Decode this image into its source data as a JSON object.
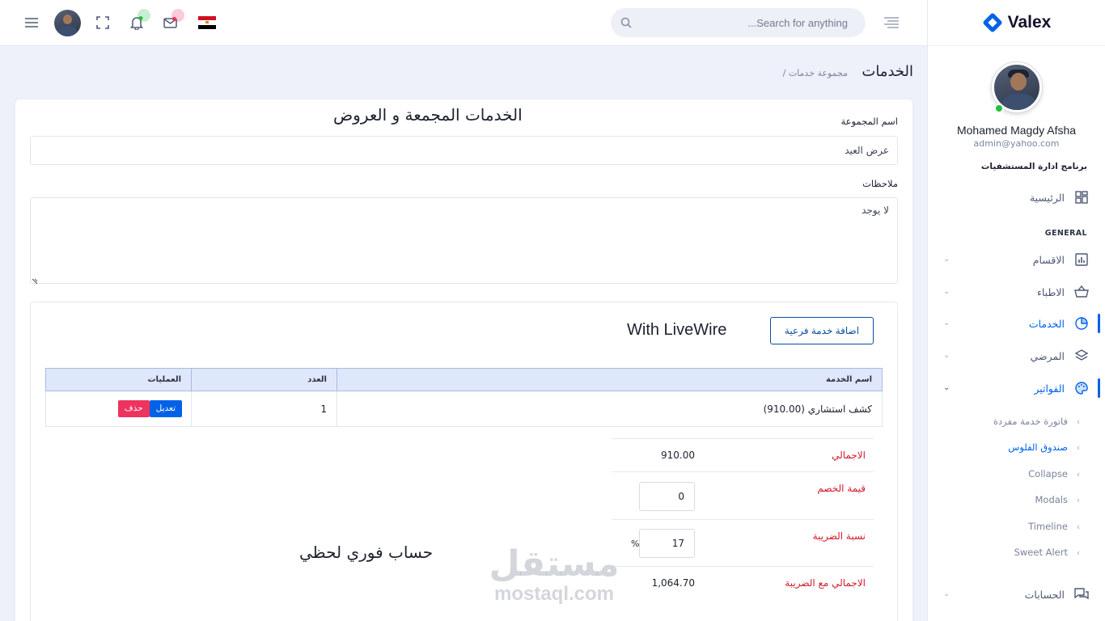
{
  "brand": {
    "name": "Valex"
  },
  "header": {
    "search_placeholder": "...Search for anything"
  },
  "profile": {
    "name": "Mohamed Magdy Afsha",
    "email": "admin@yahoo.com",
    "online_color": "#22c03c"
  },
  "sidebar": {
    "app_title": "برنامج ادارة المستشفيات",
    "home": "الرئيسية",
    "section": "GENERAL",
    "items": [
      {
        "label": "الاقسام",
        "icon": "bar-chart-icon"
      },
      {
        "label": "الاطباء",
        "icon": "basket-icon"
      },
      {
        "label": "الخدمات",
        "icon": "pie-chart-icon",
        "active": true
      },
      {
        "label": "المرضي",
        "icon": "layers-icon"
      },
      {
        "label": "الفواتير",
        "icon": "palette-icon",
        "active": true,
        "expanded": true
      }
    ],
    "sub_items": [
      {
        "label": "فاتورة خدمة مفردة"
      },
      {
        "label": "صندوق الفلوس",
        "active": true
      },
      {
        "label": "Collapse"
      },
      {
        "label": "Modals"
      },
      {
        "label": "Timeline"
      },
      {
        "label": "Sweet Alert"
      }
    ],
    "accounts": "الحسابات"
  },
  "breadcrumb": {
    "title": "الخدمات",
    "sub": "/ مجموعة خدمات"
  },
  "form": {
    "card_title": "الخدمات المجمعة و العروض",
    "group_name_label": "اسم المجموعة",
    "group_name_value": "عرض العيد",
    "notes_label": "ملاحظات",
    "notes_value": "لا يوجد"
  },
  "services": {
    "add_button": "اضافة خدمة فرعية",
    "livewire_title": "With LiveWire",
    "columns": [
      "اسم الخدمة",
      "العدد",
      "العمليات"
    ],
    "rows": [
      {
        "name": "كشف استشاري (910.00)",
        "count": "1",
        "edit": "تعديل",
        "delete": "حذف"
      }
    ]
  },
  "totals": {
    "total_label": "الاجمالي",
    "total_value": "910.00",
    "discount_label": "قيمة الخصم",
    "discount_value": "0",
    "tax_label": "نسبة الضريبة",
    "tax_value": "17",
    "tax_unit": "%",
    "total_tax_label": "الاجمالي مع الضريبة",
    "total_tax_value": "1,064.70",
    "calc_title": "حساب فوري لحظي"
  },
  "watermark": {
    "ar": "مستقل",
    "en": "mostaql.com"
  },
  "colors": {
    "primary": "#0162e8",
    "danger": "#ee335e",
    "label_red": "#d21c2a",
    "notif_green": "#22c03c",
    "mail_red": "#ee335e"
  }
}
